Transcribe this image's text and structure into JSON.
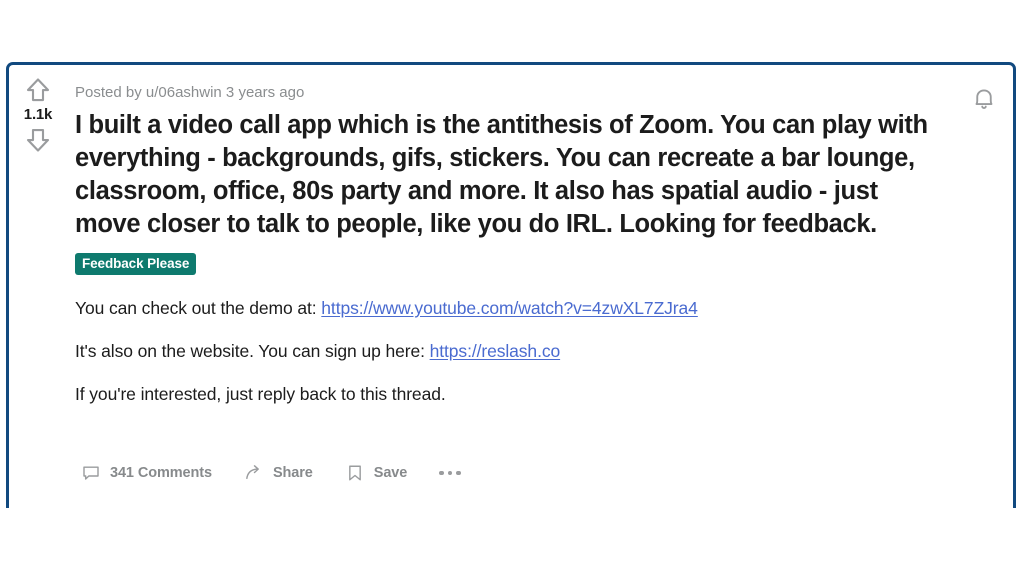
{
  "post": {
    "meta": "Posted by u/06ashwin 3 years ago",
    "author": "u/06ashwin",
    "age": "3 years ago",
    "title": "I built a video call app which is the antithesis of Zoom. You can play with everything - backgrounds, gifs, stickers. You can recreate a bar lounge, classroom, office, 80s party and more. It also has spatial audio - just move closer to talk to people, like you do IRL. Looking for feedback.",
    "flair": "Feedback Please",
    "flair_color": "#0e7a6e",
    "body": {
      "p1_prefix": "You can check out the demo at: ",
      "p1_link": "https://www.youtube.com/watch?v=4zwXL7ZJra4",
      "p2_prefix": "It's also on the website. You can sign up here: ",
      "p2_link": "https://reslash.co",
      "p3": "If you're interested, just reply back to this thread."
    },
    "link_color": "#4a6bd0"
  },
  "vote": {
    "score": "1.1k",
    "upvote_icon": "arrow-up-icon",
    "downvote_icon": "arrow-down-icon"
  },
  "notifications": {
    "icon": "bell-icon"
  },
  "actions": [
    {
      "icon": "comment-icon",
      "label": "341 Comments"
    },
    {
      "icon": "share-icon",
      "label": "Share"
    },
    {
      "icon": "bookmark-icon",
      "label": "Save"
    }
  ],
  "more": {
    "icon": "ellipsis-icon"
  },
  "theme": {
    "card_border": "#11497f",
    "text": "#1c1c1c",
    "muted": "#878a8c"
  }
}
